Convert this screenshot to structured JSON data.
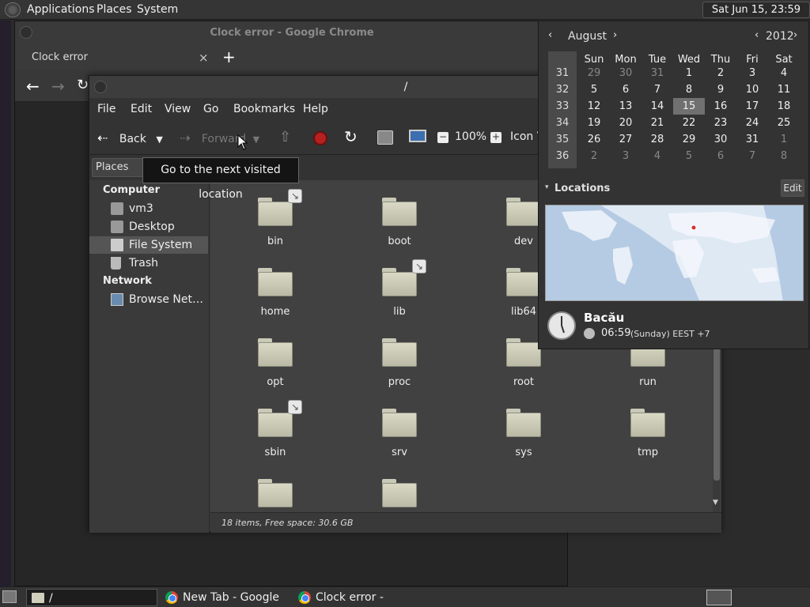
{
  "top_panel": {
    "menus": [
      "Applications",
      "Places",
      "System"
    ],
    "clock": "Sat Jun 15, 23:59"
  },
  "chrome": {
    "window_title": "Clock error - Google Chrome",
    "tab_title": "Clock error",
    "new_tab_symbol": "+",
    "tab_close_symbol": "×"
  },
  "file_manager": {
    "title": "/",
    "menu": [
      "File",
      "Edit",
      "View",
      "Go",
      "Bookmarks",
      "Help"
    ],
    "toolbar": {
      "back": "Back",
      "forward": "Forward",
      "zoom": "100%",
      "view_mode": "Icon V"
    },
    "places_label": "Places",
    "tooltip": "Go to the next visited location",
    "sidebar": {
      "computer_header": "Computer",
      "computer_items": [
        "vm3",
        "Desktop",
        "File System",
        "Trash"
      ],
      "network_header": "Network",
      "network_items": [
        "Browse Net…"
      ]
    },
    "folders": [
      "bin",
      "boot",
      "dev",
      "home",
      "lib",
      "lib64",
      "opt",
      "proc",
      "root",
      "run",
      "sbin",
      "srv",
      "sys",
      "tmp",
      "",
      ""
    ],
    "status": "18 items, Free space: 30.6 GB"
  },
  "calendar": {
    "month": "August",
    "year": "2012",
    "day_names": [
      "Sun",
      "Mon",
      "Tue",
      "Wed",
      "Thu",
      "Fri",
      "Sat"
    ],
    "weeks": [
      {
        "week": "31",
        "days": [
          "29",
          "30",
          "31",
          "1",
          "2",
          "3",
          "4"
        ]
      },
      {
        "week": "32",
        "days": [
          "5",
          "6",
          "7",
          "8",
          "9",
          "10",
          "11"
        ]
      },
      {
        "week": "33",
        "days": [
          "12",
          "13",
          "14",
          "15",
          "16",
          "17",
          "18"
        ]
      },
      {
        "week": "34",
        "days": [
          "19",
          "20",
          "21",
          "22",
          "23",
          "24",
          "25"
        ]
      },
      {
        "week": "35",
        "days": [
          "26",
          "27",
          "28",
          "29",
          "30",
          "31",
          "1"
        ]
      },
      {
        "week": "36",
        "days": [
          "2",
          "3",
          "4",
          "5",
          "6",
          "7",
          "8"
        ]
      }
    ],
    "highlighted_day": "15",
    "locations_label": "Locations",
    "edit_label": "Edit",
    "location": {
      "city": "Bacău",
      "time": "06:59",
      "detail": "(Sunday) EEST +7"
    }
  },
  "taskbar": {
    "items": [
      "/",
      "New Tab - Google ...",
      "Clock error - Googl..."
    ]
  },
  "colors": {
    "panel": "#353535",
    "window": "#3a3a3a",
    "content": "#414141",
    "tooltip_bg": "#141414",
    "map_ocean": "#dbe8f5",
    "map_land": "#a8c4e0"
  }
}
